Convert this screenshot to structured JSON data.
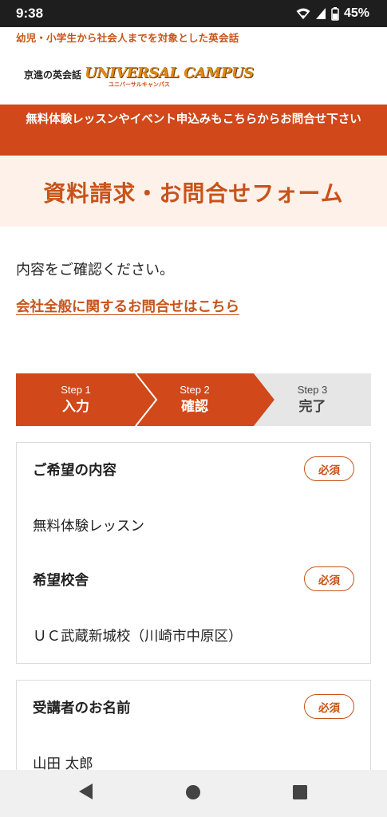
{
  "status_bar": {
    "time": "9:38",
    "battery": "45%",
    "icons": [
      "wifi-icon",
      "signal-icon",
      "battery-icon"
    ]
  },
  "header": {
    "tagline": "幼児・小学生から社会人までを対象とした英会話",
    "logo_jp": "京進の英会話",
    "logo_en": "UNIVERSAL CAMPUS",
    "logo_kana": "ユニバーサルキャンパス"
  },
  "banner": {
    "text": "無料体験レッスンやイベント申込みもこちらからお問合せ下さい"
  },
  "page_title": "資料請求・お問合せフォーム",
  "confirm_text": "内容をご確認ください。",
  "company_link": "会社全般に関するお問合せはこちら",
  "steps": [
    {
      "num": "Step 1",
      "label": "入力",
      "state": "done"
    },
    {
      "num": "Step 2",
      "label": "確認",
      "state": "current"
    },
    {
      "num": "Step 3",
      "label": "完了",
      "state": "pending"
    }
  ],
  "fields": [
    {
      "label": "ご希望の内容",
      "required": "必須",
      "value": "無料体験レッスン"
    },
    {
      "label": "希望校舎",
      "required": "必須",
      "value": "ＵＣ武蔵新城校（川崎市中原区）"
    },
    {
      "label": "受講者のお名前",
      "required": "必須",
      "value": "山田 太郎"
    }
  ],
  "colors": {
    "accent": "#d1481a",
    "accent_text": "#c8531a",
    "title_bg": "#fdf1e9",
    "step_pending": "#e6e6e6"
  },
  "nav_bar": {
    "icons": [
      "back-icon",
      "home-icon",
      "recents-icon"
    ]
  }
}
